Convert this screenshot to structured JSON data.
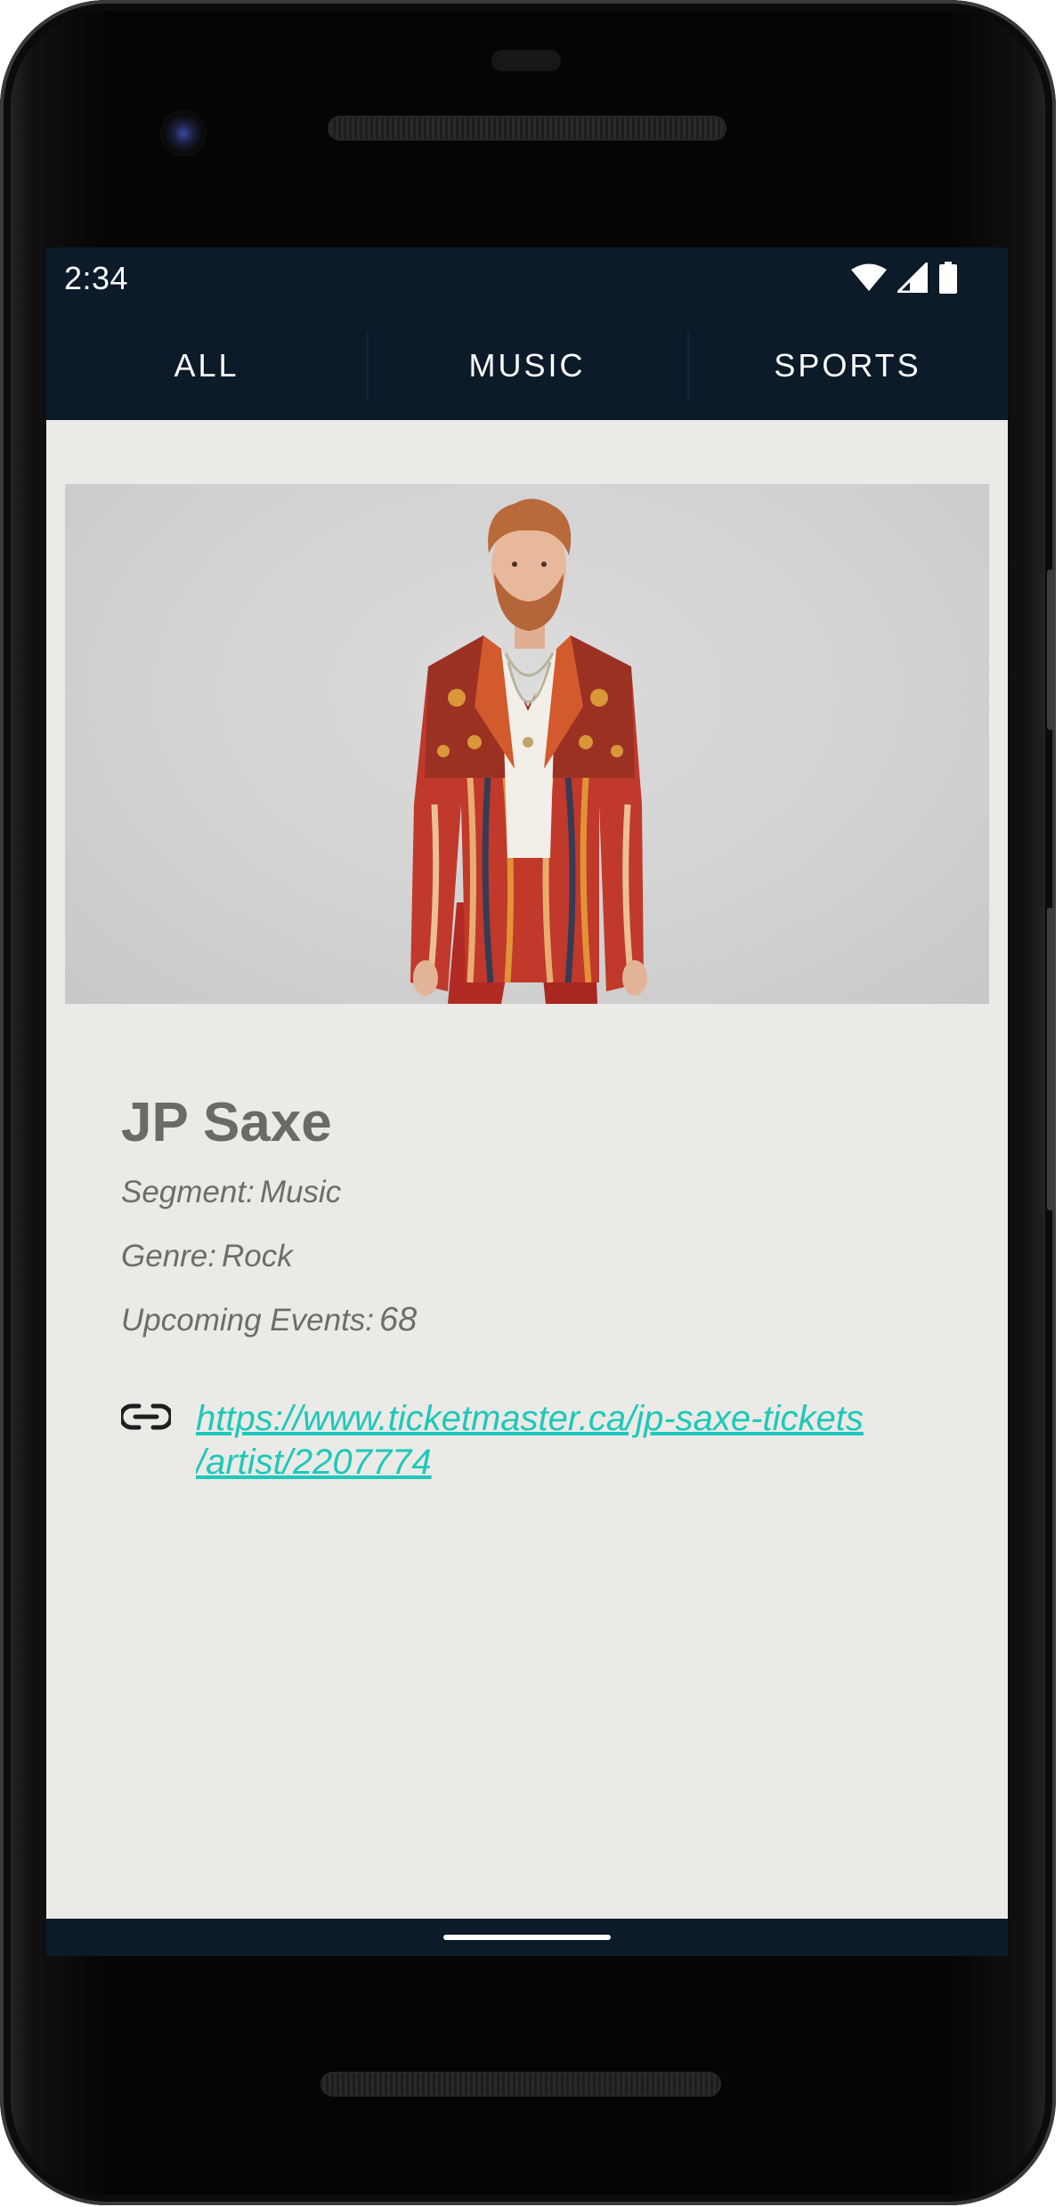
{
  "status_bar": {
    "time": "2:34",
    "icons": [
      "wifi-icon",
      "cellular-signal-icon",
      "battery-icon"
    ]
  },
  "tabs": [
    {
      "label": "ALL"
    },
    {
      "label": "MUSIC"
    },
    {
      "label": "SPORTS"
    }
  ],
  "artist": {
    "name": "JP Saxe",
    "segment_label": "Segment:",
    "segment_value": "Music",
    "genre_label": "Genre:",
    "genre_value": "Rock",
    "events_label": "Upcoming Events:",
    "events_value": "68",
    "link_line1": "https://www.ticketmaster.ca/jp-saxe-tickets",
    "link_line2": "/artist/2207774",
    "link_icon": "link-icon"
  },
  "colors": {
    "app_bar": "#0c1a29",
    "background": "#ebeae6",
    "link": "#1ec8ba",
    "text": "#6d6d69"
  }
}
